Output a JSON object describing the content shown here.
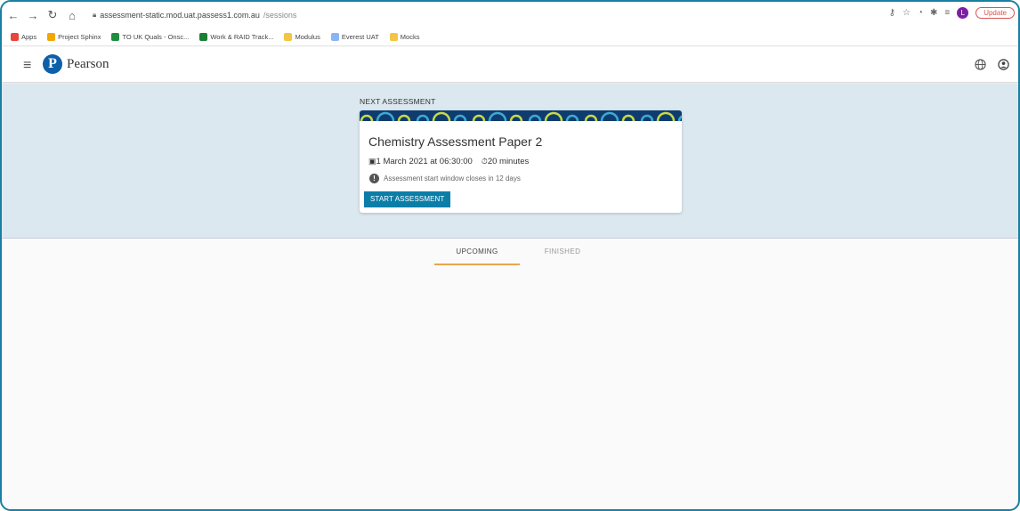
{
  "browser": {
    "url_host": "assessment-static.mod.uat.passess1.com.au",
    "url_path": "/sessions",
    "update_label": "Update",
    "profile_initial": "L"
  },
  "bookmarks": [
    {
      "label": "Apps",
      "color": "#e8453c"
    },
    {
      "label": "Project Sphinx",
      "color": "#f2a600"
    },
    {
      "label": "TO UK Quals - Onsc...",
      "color": "#1e8e3e"
    },
    {
      "label": "Work & RAID Track...",
      "color": "#1e7e34"
    },
    {
      "label": "Modulus",
      "color": "#f4c542"
    },
    {
      "label": "Everest UAT",
      "color": "#8ab4f8"
    },
    {
      "label": "Mocks",
      "color": "#f4c542"
    }
  ],
  "header": {
    "brand": "Pearson",
    "brand_mark": "P"
  },
  "next": {
    "label": "NEXT ASSESSMENT",
    "title": "Chemistry Assessment Paper 2",
    "date": "1 March 2021 at 06:30:00",
    "duration": "20 minutes",
    "notice": "Assessment start window closes in 12 days",
    "start_label": "START ASSESSMENT"
  },
  "tabs": [
    {
      "label": "UPCOMING",
      "active": true
    },
    {
      "label": "FINISHED",
      "active": false
    }
  ],
  "colors": {
    "accent": "#0b7ea8",
    "hero_bg": "#dce8ef",
    "tab_underline": "#e8a54a",
    "banner_bg": "#0f3c6e",
    "banner_ring": "#c8d94a"
  }
}
